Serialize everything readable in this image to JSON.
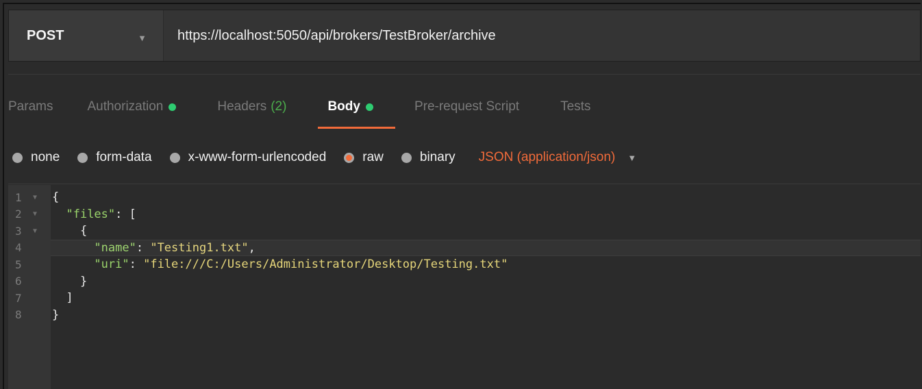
{
  "request": {
    "method": "POST",
    "url": "https://localhost:5050/api/brokers/TestBroker/archive"
  },
  "tabs": [
    {
      "label": "Params"
    },
    {
      "label": "Authorization"
    },
    {
      "label": "Headers",
      "count": "(2)"
    },
    {
      "label": "Body"
    },
    {
      "label": "Pre-request Script"
    },
    {
      "label": "Tests"
    }
  ],
  "active_tab": "Body",
  "body_options": {
    "none": "none",
    "form_data": "form-data",
    "urlencoded": "x-www-form-urlencoded",
    "raw": "raw",
    "binary": "binary",
    "selected": "raw",
    "content_type": "JSON (application/json)"
  },
  "editor": {
    "line_numbers": [
      "1",
      "2",
      "3",
      "4",
      "5",
      "6",
      "7",
      "8"
    ],
    "lines": {
      "l1": "{",
      "l2_indent": "  ",
      "l2_key": "\"files\"",
      "l2_rest": ": [",
      "l3": "    {",
      "l4_indent": "      ",
      "l4_key": "\"name\"",
      "l4_sep": ": ",
      "l4_val": "\"Testing1.txt\"",
      "l4_end": ",",
      "l5_indent": "      ",
      "l5_key": "\"uri\"",
      "l5_sep": ": ",
      "l5_val": "\"file:///C:/Users/Administrator/Desktop/Testing.txt\"",
      "l6": "    }",
      "l7": "  ]",
      "l8": "}"
    }
  },
  "colors": {
    "accent": "#f26b3a",
    "status_dot": "#2ecc71",
    "json_key": "#9bd46b",
    "json_string": "#e6d67a"
  }
}
